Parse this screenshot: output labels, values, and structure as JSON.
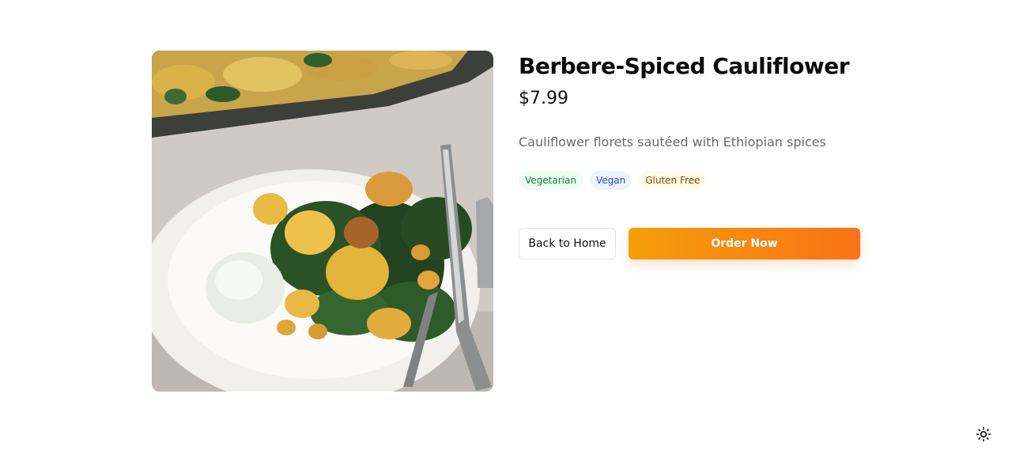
{
  "product": {
    "image_alt": "Berbere-Spiced Cauliflower",
    "title": "Berbere-Spiced Cauliflower",
    "price": "$7.99",
    "description": "Cauliflower florets sautéed with Ethiopian spices",
    "tags": [
      {
        "label": "Vegetarian",
        "color": "#15803d"
      },
      {
        "label": "Vegan",
        "color": "#1d4ed8"
      },
      {
        "label": "Gluten Free",
        "color": "#92400e"
      }
    ]
  },
  "actions": {
    "back_label": "Back to Home",
    "order_label": "Order Now"
  },
  "colors": {
    "accent_start": "#f59e0b",
    "accent_end": "#f97316"
  },
  "theme_toggle": {
    "icon": "sun-icon"
  }
}
